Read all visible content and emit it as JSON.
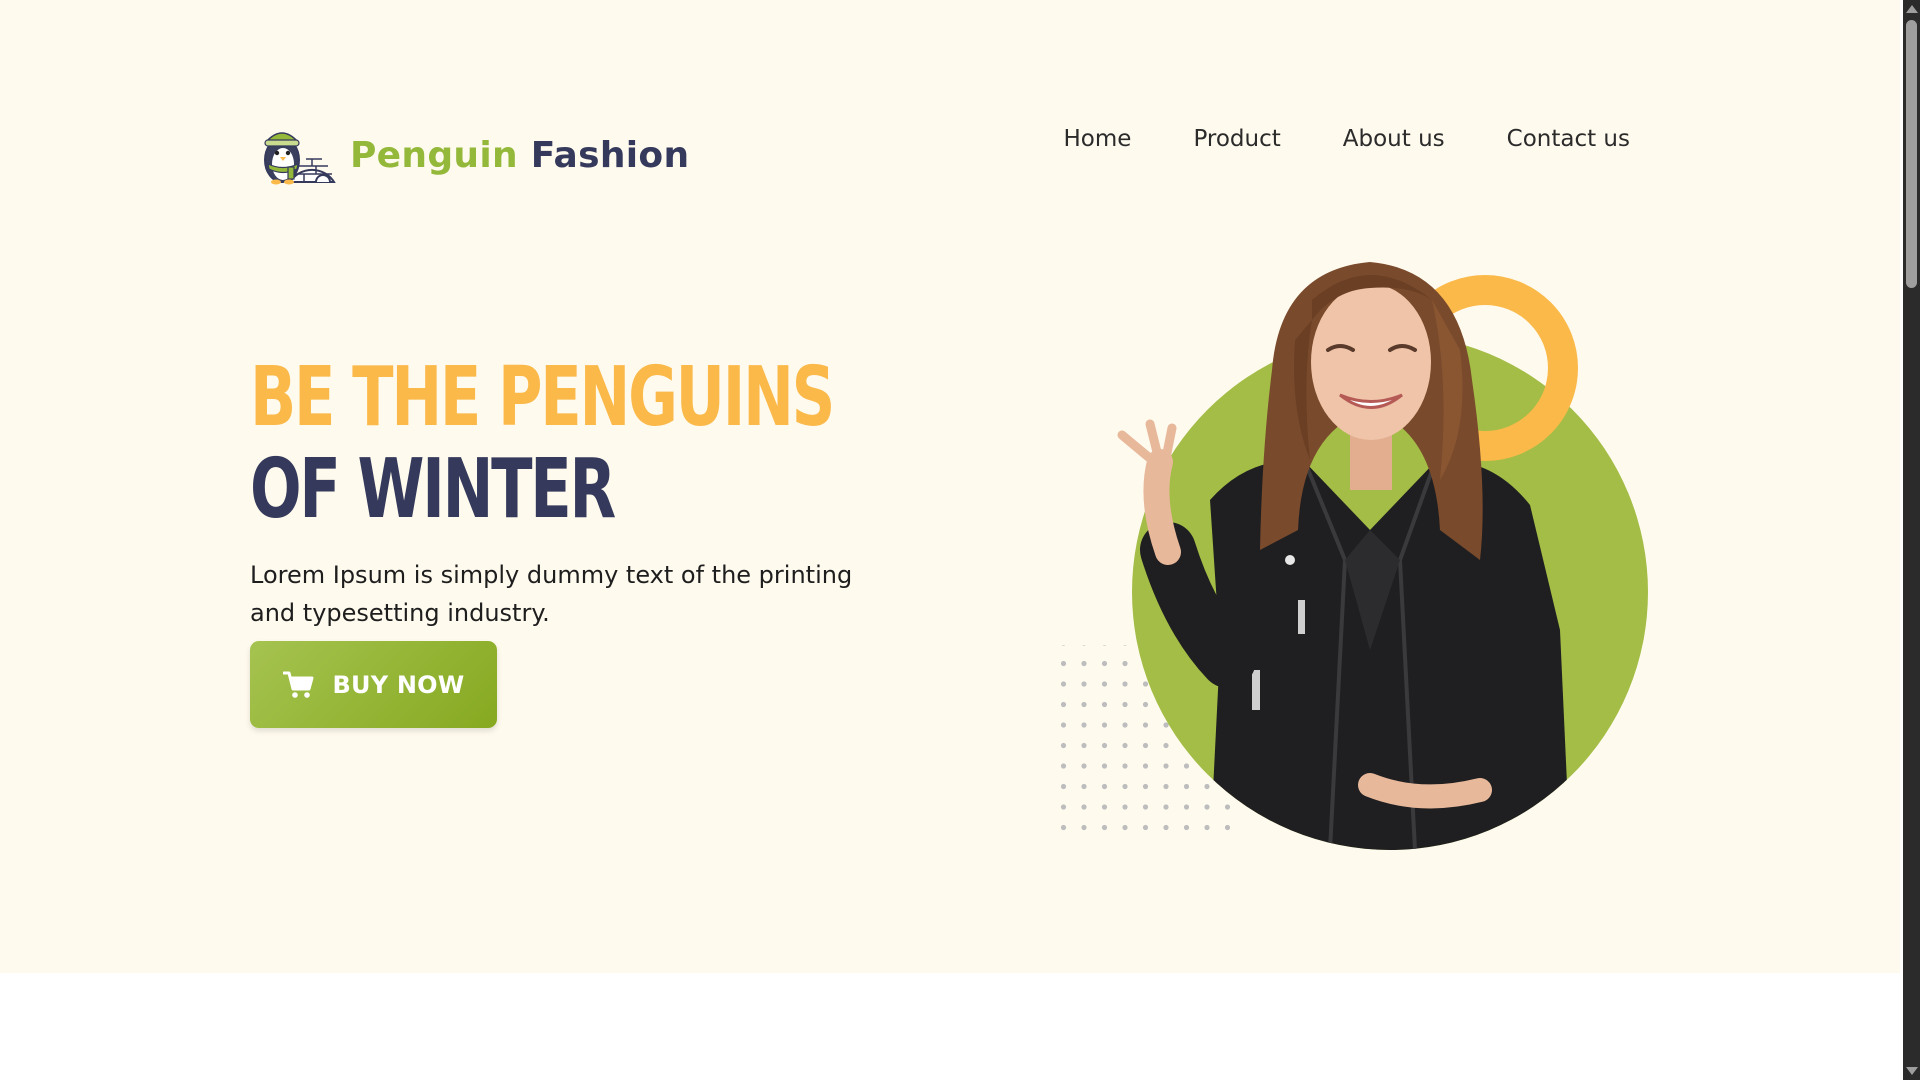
{
  "brand": {
    "part1": "Penguin",
    "part2": "Fashion"
  },
  "nav": {
    "items": [
      "Home",
      "Product",
      "About us",
      "Contact us"
    ]
  },
  "hero": {
    "headline_line1": "BE THE PENGUINS",
    "headline_line2": "OF WINTER",
    "subtitle": "Lorem Ipsum is simply dummy text of the printing and typesetting industry.",
    "cta_label": "BUY NOW"
  },
  "icons": {
    "logo": "penguin-igloo-icon",
    "cart": "cart-icon",
    "ring": "ring-decoration",
    "dots": "dot-grid-decoration"
  },
  "colors": {
    "accent_green": "#a3c14a",
    "accent_yellow": "#fbb94a",
    "navy": "#353a5c",
    "background": "#fffaee"
  }
}
